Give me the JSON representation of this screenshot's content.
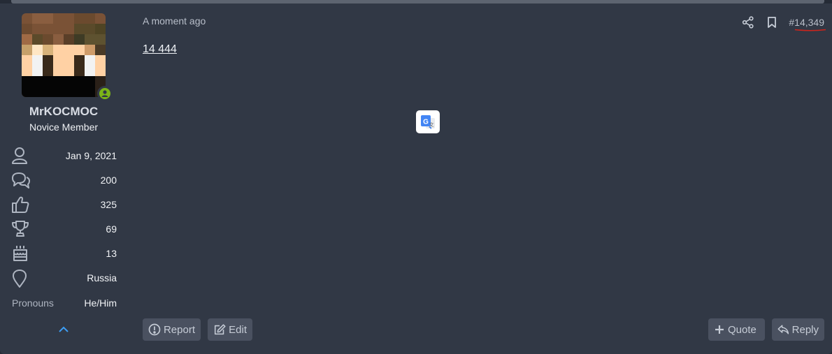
{
  "user": {
    "name": "MrKOCMOC",
    "title": "Novice Member",
    "online": true,
    "stats": [
      {
        "icon": "user-icon",
        "value": "Jan 9, 2021"
      },
      {
        "icon": "messages-icon",
        "value": "200"
      },
      {
        "icon": "thumbs-up-icon",
        "value": "325"
      },
      {
        "icon": "trophy-icon",
        "value": "69"
      },
      {
        "icon": "birthday-cake-icon",
        "value": "13"
      },
      {
        "icon": "location-pin-icon",
        "value": "Russia"
      }
    ],
    "pronouns": {
      "label": "Pronouns",
      "value": "He/Him"
    }
  },
  "post": {
    "date": "A moment ago",
    "number": "#14,349",
    "body": "14 444"
  },
  "actions": {
    "report": "Report",
    "edit": "Edit",
    "quote": "Quote",
    "reply": "Reply"
  },
  "colors": {
    "page_bg": "#252b36",
    "post_bg": "#313845",
    "button_bg": "#4a5160",
    "online_green": "#7cb518",
    "accent_blue": "#3d9ef5",
    "annotation_red": "#d0241b"
  }
}
